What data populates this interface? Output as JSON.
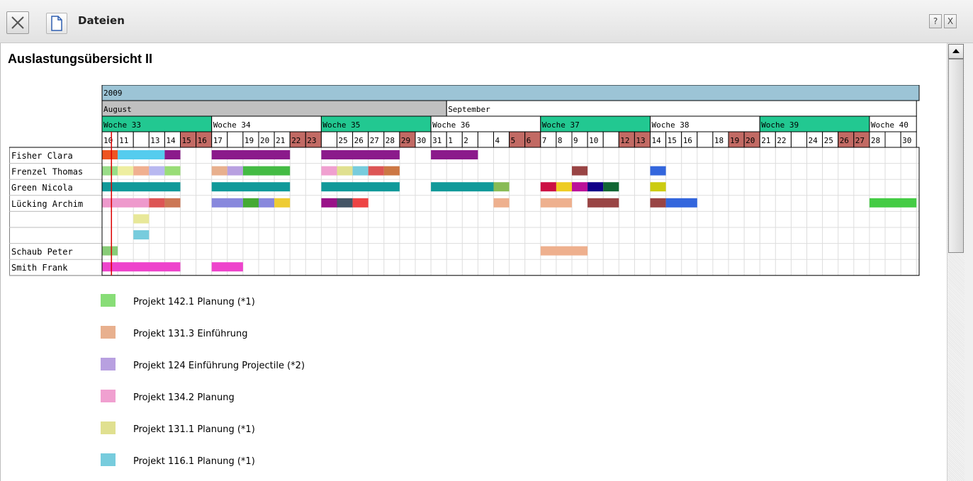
{
  "window": {
    "title": "Dateien",
    "help_label": "?",
    "close_label": "X"
  },
  "report": {
    "title": "Auslastungsübersicht II"
  },
  "timeline": {
    "year": "2009",
    "months": [
      {
        "name": "August",
        "first_day": 0,
        "last_day": 21
      },
      {
        "name": "September",
        "first_day": 22,
        "last_day": 51
      }
    ],
    "weeks": [
      {
        "label": "Woche 33",
        "first_day": 0,
        "last_day": 6,
        "highlight": true
      },
      {
        "label": "Woche 34",
        "first_day": 7,
        "last_day": 13,
        "highlight": false
      },
      {
        "label": "Woche 35",
        "first_day": 14,
        "last_day": 20,
        "highlight": true
      },
      {
        "label": "Woche 36",
        "first_day": 21,
        "last_day": 27,
        "highlight": false
      },
      {
        "label": "Woche 37",
        "first_day": 28,
        "last_day": 34,
        "highlight": true
      },
      {
        "label": "Woche 38",
        "first_day": 35,
        "last_day": 41,
        "highlight": false
      },
      {
        "label": "Woche 39",
        "first_day": 42,
        "last_day": 48,
        "highlight": true
      },
      {
        "label": "Woche 40",
        "first_day": 49,
        "last_day": 51,
        "highlight": false
      }
    ],
    "days": [
      "10",
      "11",
      "12",
      "13",
      "14",
      "15",
      "16",
      "17",
      "18",
      "19",
      "20",
      "21",
      "22",
      "23",
      "24",
      "25",
      "26",
      "27",
      "28",
      "29",
      "30",
      "31",
      "1",
      "2",
      "3",
      "4",
      "5",
      "6",
      "7",
      "8",
      "9",
      "10",
      "11",
      "12",
      "13",
      "14",
      "15",
      "16",
      "17",
      "18",
      "19",
      "20",
      "21",
      "22",
      "23",
      "24",
      "25",
      "26",
      "27",
      "28",
      "29",
      "30"
    ],
    "hidden_day_labels": [
      2,
      8,
      14,
      24,
      32,
      38,
      44,
      50
    ],
    "weekend_days": [
      5,
      6,
      12,
      13,
      19,
      26,
      27,
      33,
      34,
      40,
      41,
      47,
      48
    ],
    "today_day": 0.6,
    "colors": {
      "year_bg": "#9cc4d6",
      "month_bg": "#c0c0c0",
      "week_highlight": "#22c891",
      "weekend": "#c26a64",
      "today_line": "#dd0000"
    }
  },
  "resources": [
    {
      "name": "Fisher Clara"
    },
    {
      "name": "Frenzel Thomas"
    },
    {
      "name": "Green Nicola"
    },
    {
      "name": "Lücking Archim"
    },
    {
      "name": ""
    },
    {
      "name": ""
    },
    {
      "name": "Schaub Peter"
    },
    {
      "name": "Smith Frank"
    }
  ],
  "bookings": [
    {
      "row": 0,
      "start": 0,
      "end": 1,
      "color": "#ee5522"
    },
    {
      "row": 0,
      "start": 1,
      "end": 4,
      "color": "#55ccee"
    },
    {
      "row": 0,
      "start": 4,
      "end": 5,
      "color": "#8b1a8b"
    },
    {
      "row": 0,
      "start": 7,
      "end": 12,
      "color": "#8b1a8b"
    },
    {
      "row": 0,
      "start": 14,
      "end": 19,
      "color": "#8b1a8b"
    },
    {
      "row": 0,
      "start": 21,
      "end": 24,
      "color": "#8b1a8b"
    },
    {
      "row": 1,
      "start": 0,
      "end": 1,
      "color": "#99dd88"
    },
    {
      "row": 1,
      "start": 1,
      "end": 2,
      "color": "#eeeea0"
    },
    {
      "row": 1,
      "start": 2,
      "end": 3,
      "color": "#f0b090"
    },
    {
      "row": 1,
      "start": 3,
      "end": 4,
      "color": "#b8b8f0"
    },
    {
      "row": 1,
      "start": 4,
      "end": 5,
      "color": "#99dd77"
    },
    {
      "row": 1,
      "start": 7,
      "end": 8,
      "color": "#e8b08e"
    },
    {
      "row": 1,
      "start": 8,
      "end": 9,
      "color": "#b8a0e0"
    },
    {
      "row": 1,
      "start": 9,
      "end": 12,
      "color": "#44bb44"
    },
    {
      "row": 1,
      "start": 14,
      "end": 15,
      "color": "#f0a0d0"
    },
    {
      "row": 1,
      "start": 15,
      "end": 16,
      "color": "#e0e090"
    },
    {
      "row": 1,
      "start": 16,
      "end": 17,
      "color": "#77ccdd"
    },
    {
      "row": 1,
      "start": 17,
      "end": 18,
      "color": "#dd5555"
    },
    {
      "row": 1,
      "start": 18,
      "end": 19,
      "color": "#cc7744"
    },
    {
      "row": 1,
      "start": 30,
      "end": 31,
      "color": "#994444"
    },
    {
      "row": 1,
      "start": 35,
      "end": 36,
      "color": "#3366dd"
    },
    {
      "row": 2,
      "start": 0,
      "end": 5,
      "color": "#119999"
    },
    {
      "row": 2,
      "start": 7,
      "end": 12,
      "color": "#119999"
    },
    {
      "row": 2,
      "start": 14,
      "end": 19,
      "color": "#119999"
    },
    {
      "row": 2,
      "start": 21,
      "end": 25,
      "color": "#119999"
    },
    {
      "row": 2,
      "start": 25,
      "end": 26,
      "color": "#88bb55"
    },
    {
      "row": 2,
      "start": 28,
      "end": 29,
      "color": "#cc1144"
    },
    {
      "row": 2,
      "start": 29,
      "end": 30,
      "color": "#eecc22"
    },
    {
      "row": 2,
      "start": 30,
      "end": 31,
      "color": "#bb1199"
    },
    {
      "row": 2,
      "start": 31,
      "end": 32,
      "color": "#110088"
    },
    {
      "row": 2,
      "start": 32,
      "end": 33,
      "color": "#116633"
    },
    {
      "row": 2,
      "start": 35,
      "end": 36,
      "color": "#cccc11"
    },
    {
      "row": 3,
      "start": 0,
      "end": 3,
      "color": "#ee99cc"
    },
    {
      "row": 3,
      "start": 3,
      "end": 4,
      "color": "#dd5555"
    },
    {
      "row": 3,
      "start": 4,
      "end": 5,
      "color": "#cc7755"
    },
    {
      "row": 3,
      "start": 7,
      "end": 9,
      "color": "#8888dd"
    },
    {
      "row": 3,
      "start": 9,
      "end": 10,
      "color": "#44aa33"
    },
    {
      "row": 3,
      "start": 10,
      "end": 11,
      "color": "#8888dd"
    },
    {
      "row": 3,
      "start": 11,
      "end": 12,
      "color": "#eecc33"
    },
    {
      "row": 3,
      "start": 14,
      "end": 15,
      "color": "#991188"
    },
    {
      "row": 3,
      "start": 15,
      "end": 16,
      "color": "#445566"
    },
    {
      "row": 3,
      "start": 16,
      "end": 17,
      "color": "#ee4444"
    },
    {
      "row": 3,
      "start": 25,
      "end": 26,
      "color": "#eeb08e"
    },
    {
      "row": 3,
      "start": 28,
      "end": 30,
      "color": "#eeb08e"
    },
    {
      "row": 3,
      "start": 31,
      "end": 33,
      "color": "#994444"
    },
    {
      "row": 3,
      "start": 35,
      "end": 36,
      "color": "#994444"
    },
    {
      "row": 3,
      "start": 36,
      "end": 38,
      "color": "#3366dd"
    },
    {
      "row": 3,
      "start": 49,
      "end": 52,
      "color": "#44cc44"
    },
    {
      "row": 4,
      "start": 2,
      "end": 3,
      "color": "#e8e899"
    },
    {
      "row": 5,
      "start": 2,
      "end": 3,
      "color": "#77ccdd"
    },
    {
      "row": 6,
      "start": 0,
      "end": 1,
      "color": "#88cc77"
    },
    {
      "row": 6,
      "start": 28,
      "end": 31,
      "color": "#eeb08e"
    },
    {
      "row": 7,
      "start": 0,
      "end": 5,
      "color": "#ee44cc"
    },
    {
      "row": 7,
      "start": 7,
      "end": 9,
      "color": "#ee44cc"
    }
  ],
  "legend": [
    {
      "label": "Projekt 142.1 Planung (*1)",
      "color": "#88dd77"
    },
    {
      "label": "Projekt 131.3 Einführung",
      "color": "#e8b08e"
    },
    {
      "label": "Projekt 124 Einführung Projectile (*2)",
      "color": "#b8a0e0"
    },
    {
      "label": "Projekt 134.2 Planung",
      "color": "#f0a0d0"
    },
    {
      "label": "Projekt 131.1 Planung (*1)",
      "color": "#e0e090"
    },
    {
      "label": "Projekt 116.1 Planung (*1)",
      "color": "#77ccdd"
    }
  ]
}
